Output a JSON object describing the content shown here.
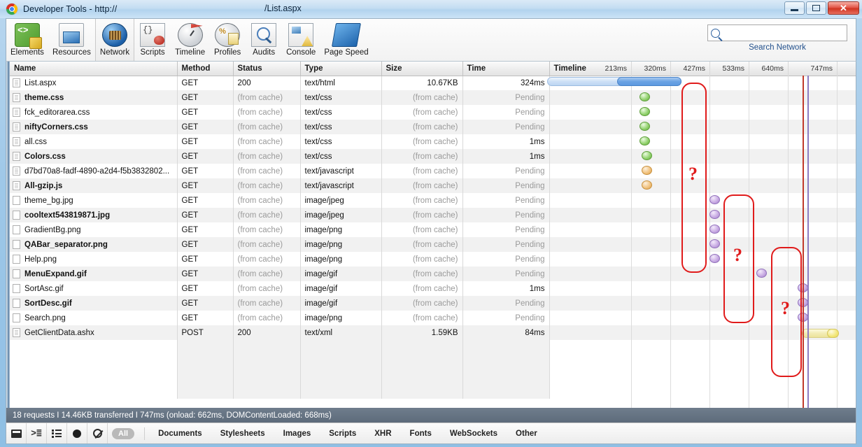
{
  "window": {
    "title": "Developer Tools - http://",
    "url_right": "/List.aspx",
    "minimize": "–",
    "maximize": "☐",
    "close": "✕"
  },
  "toolbar": {
    "tabs": [
      {
        "label": "Elements",
        "icon": "elements-icon",
        "active": false
      },
      {
        "label": "Resources",
        "icon": "resources-icon",
        "active": false
      },
      {
        "label": "Network",
        "icon": "network-icon",
        "active": true
      },
      {
        "label": "Scripts",
        "icon": "scripts-icon",
        "active": false
      },
      {
        "label": "Timeline",
        "icon": "timeline-icon",
        "active": false
      },
      {
        "label": "Profiles",
        "icon": "profiles-icon",
        "active": false
      },
      {
        "label": "Audits",
        "icon": "audits-icon",
        "active": false
      },
      {
        "label": "Console",
        "icon": "console-icon",
        "active": false
      },
      {
        "label": "Page Speed",
        "icon": "pagespeed-icon",
        "active": false
      }
    ],
    "search": {
      "value": "",
      "placeholder": "",
      "label": "Search Network",
      "icon": "search-icon"
    }
  },
  "table": {
    "columns": [
      "Name",
      "Method",
      "Status",
      "Type",
      "Size",
      "Time",
      "Timeline"
    ],
    "rows": [
      {
        "name": "List.aspx",
        "method": "GET",
        "status": "200",
        "type": "text/html",
        "size": "10.67KB",
        "time": "324ms",
        "bold": false,
        "status_dim": false,
        "size_dim": false,
        "time_dim": false,
        "icon": "file-icon"
      },
      {
        "name": "theme.css",
        "method": "GET",
        "status": "(from cache)",
        "type": "text/css",
        "size": "(from cache)",
        "time": "Pending",
        "bold": true,
        "status_dim": true,
        "size_dim": true,
        "time_dim": true,
        "icon": "file-icon"
      },
      {
        "name": "fck_editorarea.css",
        "method": "GET",
        "status": "(from cache)",
        "type": "text/css",
        "size": "(from cache)",
        "time": "Pending",
        "bold": false,
        "status_dim": true,
        "size_dim": true,
        "time_dim": true,
        "icon": "file-icon"
      },
      {
        "name": "niftyCorners.css",
        "method": "GET",
        "status": "(from cache)",
        "type": "text/css",
        "size": "(from cache)",
        "time": "Pending",
        "bold": true,
        "status_dim": true,
        "size_dim": true,
        "time_dim": true,
        "icon": "file-icon"
      },
      {
        "name": "all.css",
        "method": "GET",
        "status": "(from cache)",
        "type": "text/css",
        "size": "(from cache)",
        "time": "1ms",
        "bold": false,
        "status_dim": true,
        "size_dim": true,
        "time_dim": false,
        "icon": "file-icon"
      },
      {
        "name": "Colors.css",
        "method": "GET",
        "status": "(from cache)",
        "type": "text/css",
        "size": "(from cache)",
        "time": "1ms",
        "bold": true,
        "status_dim": true,
        "size_dim": true,
        "time_dim": false,
        "icon": "file-icon"
      },
      {
        "name": "d7bd70a8-fadf-4890-a2d4-f5b3832802...",
        "method": "GET",
        "status": "(from cache)",
        "type": "text/javascript",
        "size": "(from cache)",
        "time": "Pending",
        "bold": false,
        "status_dim": true,
        "size_dim": true,
        "time_dim": true,
        "icon": "file-icon"
      },
      {
        "name": "All-gzip.js",
        "method": "GET",
        "status": "(from cache)",
        "type": "text/javascript",
        "size": "(from cache)",
        "time": "Pending",
        "bold": true,
        "status_dim": true,
        "size_dim": true,
        "time_dim": true,
        "icon": "file-icon"
      },
      {
        "name": "theme_bg.jpg",
        "method": "GET",
        "status": "(from cache)",
        "type": "image/jpeg",
        "size": "(from cache)",
        "time": "Pending",
        "bold": false,
        "status_dim": true,
        "size_dim": true,
        "time_dim": true,
        "icon": "image-icon"
      },
      {
        "name": "cooltext543819871.jpg",
        "method": "GET",
        "status": "(from cache)",
        "type": "image/jpeg",
        "size": "(from cache)",
        "time": "Pending",
        "bold": true,
        "status_dim": true,
        "size_dim": true,
        "time_dim": true,
        "icon": "image-icon"
      },
      {
        "name": "GradientBg.png",
        "method": "GET",
        "status": "(from cache)",
        "type": "image/png",
        "size": "(from cache)",
        "time": "Pending",
        "bold": false,
        "status_dim": true,
        "size_dim": true,
        "time_dim": true,
        "icon": "image-icon"
      },
      {
        "name": "QABar_separator.png",
        "method": "GET",
        "status": "(from cache)",
        "type": "image/png",
        "size": "(from cache)",
        "time": "Pending",
        "bold": true,
        "status_dim": true,
        "size_dim": true,
        "time_dim": true,
        "icon": "image-icon"
      },
      {
        "name": "Help.png",
        "method": "GET",
        "status": "(from cache)",
        "type": "image/png",
        "size": "(from cache)",
        "time": "Pending",
        "bold": false,
        "status_dim": true,
        "size_dim": true,
        "time_dim": true,
        "icon": "image-icon"
      },
      {
        "name": "MenuExpand.gif",
        "method": "GET",
        "status": "(from cache)",
        "type": "image/gif",
        "size": "(from cache)",
        "time": "Pending",
        "bold": true,
        "status_dim": true,
        "size_dim": true,
        "time_dim": true,
        "icon": "image-icon"
      },
      {
        "name": "SortAsc.gif",
        "method": "GET",
        "status": "(from cache)",
        "type": "image/gif",
        "size": "(from cache)",
        "time": "1ms",
        "bold": false,
        "status_dim": true,
        "size_dim": true,
        "time_dim": false,
        "icon": "image-icon"
      },
      {
        "name": "SortDesc.gif",
        "method": "GET",
        "status": "(from cache)",
        "type": "image/gif",
        "size": "(from cache)",
        "time": "Pending",
        "bold": true,
        "status_dim": true,
        "size_dim": true,
        "time_dim": true,
        "icon": "image-icon"
      },
      {
        "name": "Search.png",
        "method": "GET",
        "status": "(from cache)",
        "type": "image/png",
        "size": "(from cache)",
        "time": "Pending",
        "bold": false,
        "status_dim": true,
        "size_dim": true,
        "time_dim": true,
        "icon": "image-icon"
      },
      {
        "name": "GetClientData.ashx",
        "method": "POST",
        "status": "200",
        "type": "text/xml",
        "size": "1.59KB",
        "time": "84ms",
        "bold": false,
        "status_dim": false,
        "size_dim": false,
        "time_dim": false,
        "icon": "file-icon"
      }
    ]
  },
  "timeline": {
    "ticks": [
      "213ms",
      "320ms",
      "427ms",
      "533ms",
      "640ms",
      "747ms"
    ],
    "annotations": [
      {
        "label": "?"
      },
      {
        "label": "?"
      },
      {
        "label": "?"
      }
    ]
  },
  "status": {
    "text": "18 requests  I  14.46KB transferred  I  747ms (onload: 662ms, DOMContentLoaded: 668ms)"
  },
  "bottombar": {
    "buttons": [
      {
        "name": "dock-button",
        "icon": "dock-icon"
      },
      {
        "name": "console-toggle-button",
        "icon": "console-prompt-icon"
      },
      {
        "name": "list-view-button",
        "icon": "list-icon"
      },
      {
        "name": "record-button",
        "icon": "record-icon"
      },
      {
        "name": "clear-button",
        "icon": "clear-icon"
      }
    ],
    "all_label": "All",
    "filters": [
      "Documents",
      "Stylesheets",
      "Images",
      "Scripts",
      "XHR",
      "Fonts",
      "WebSockets",
      "Other"
    ]
  },
  "colors": {
    "annotation_red": "#e01b1b",
    "bubble_green": "#8fd06a",
    "bubble_orange": "#f0c07a",
    "bubble_purple": "#c6a8e2",
    "status_bg": "#6f7d8c"
  }
}
